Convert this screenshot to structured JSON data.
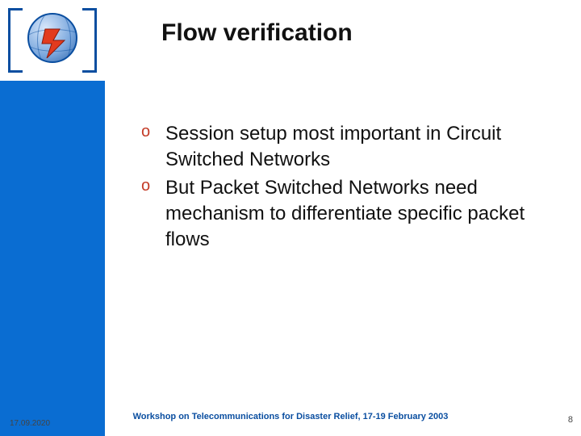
{
  "title": "Flow verification",
  "bullets": [
    {
      "marker": "o",
      "text": "Session setup most important in Circuit Switched Networks"
    },
    {
      "marker": "o",
      "text": "But Packet Switched Networks need mechanism to differentiate specific packet flows"
    }
  ],
  "footer": "Workshop on Telecommunications for Disaster Relief, 17-19 February 2003",
  "date": "17.09.2020",
  "page_number": "8",
  "colors": {
    "sidebar": "#0a6dd2",
    "accent": "#0a4ea0",
    "bullet_marker": "#c33a26"
  },
  "logo": {
    "org": "ITU",
    "icon": "globe-with-lightning"
  }
}
